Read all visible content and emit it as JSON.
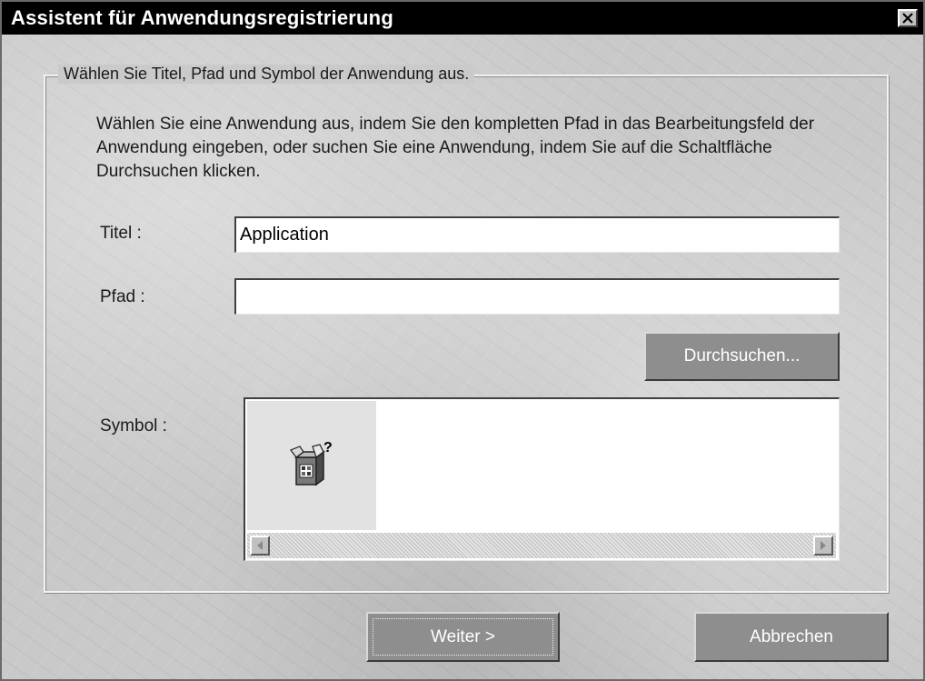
{
  "window": {
    "title": "Assistent für Anwendungsregistrierung"
  },
  "group": {
    "legend": "Wählen Sie Titel, Pfad und Symbol der Anwendung aus.",
    "description": "Wählen Sie eine Anwendung aus, indem Sie den kompletten Pfad in das Bearbeitungsfeld der Anwendung eingeben, oder suchen Sie eine Anwendung, indem Sie auf die Schaltfläche Durchsuchen klicken."
  },
  "form": {
    "title_label": "Titel :",
    "title_value": "Application",
    "path_label": "Pfad :",
    "path_value": "",
    "browse_label": "Durchsuchen...",
    "symbol_label": "Symbol :",
    "symbol_icon": "unknown-application-box-icon"
  },
  "footer": {
    "next_label": "Weiter >",
    "cancel_label": "Abbrechen"
  },
  "colors": {
    "titlebar": "#000000",
    "button_face": "#8e8e8e",
    "background": "#c9c9c9"
  }
}
